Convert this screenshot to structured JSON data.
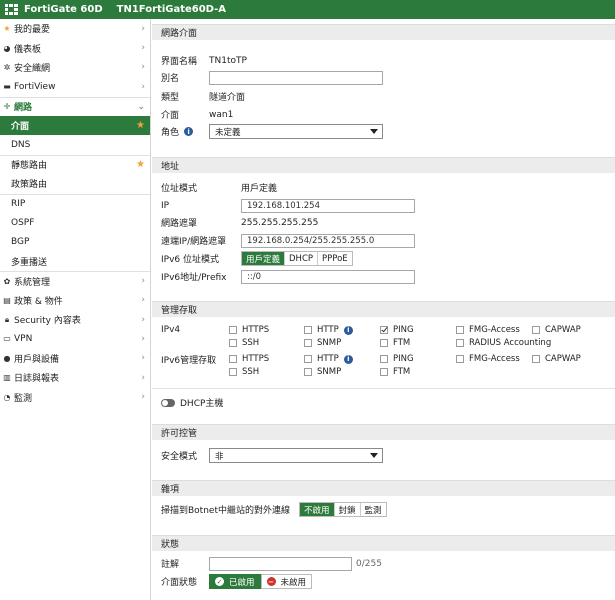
{
  "topbar": {
    "product": "FortiGate 60D",
    "hostname": "TN1FortiGate60D-A"
  },
  "sidebar": {
    "items": [
      {
        "label": "我的最愛",
        "icon": "star-icon"
      },
      {
        "label": "儀表板",
        "icon": "dashboard-icon"
      },
      {
        "label": "安全織網",
        "icon": "fabric-icon"
      },
      {
        "label": "FortiView",
        "icon": "fortiview-icon"
      },
      {
        "label": "網路",
        "icon": "network-icon"
      },
      {
        "label": "介面"
      },
      {
        "label": "DNS"
      },
      {
        "label": "靜態路由"
      },
      {
        "label": "政策路由"
      },
      {
        "label": "RIP"
      },
      {
        "label": "OSPF"
      },
      {
        "label": "BGP"
      },
      {
        "label": "多重播送"
      },
      {
        "label": "系統管理",
        "icon": "gear-icon"
      },
      {
        "label": "政策 & 物件",
        "icon": "policy-icon"
      },
      {
        "label": "Security 內容表",
        "icon": "lock-icon"
      },
      {
        "label": "VPN",
        "icon": "vpn-icon"
      },
      {
        "label": "用戶與設備",
        "icon": "user-icon"
      },
      {
        "label": "日誌與報表",
        "icon": "report-icon"
      },
      {
        "label": "監測",
        "icon": "monitor-icon"
      }
    ]
  },
  "iface": {
    "section": "網路介面",
    "name_label": "界面名稱",
    "name_value": "TN1toTP",
    "alias_label": "別名",
    "alias_value": "",
    "type_label": "類型",
    "type_value": "隧道介面",
    "interface_label": "介面",
    "interface_value": "wan1",
    "role_label": "角色",
    "role_value": "未定義"
  },
  "address": {
    "section": "地址",
    "mode_label": "位址模式",
    "mode_value": "用戶定義",
    "ip_label": "IP",
    "ip_value": "192.168.101.254",
    "mask_label": "網路遮罩",
    "mask_value": "255.255.255.255",
    "remote_label": "遠端IP/網路遮罩",
    "remote_value": "192.168.0.254/255.255.255.0",
    "ipv6mode_label": "IPv6 位址模式",
    "ipv6mode_options": [
      "用戶定義",
      "DHCP",
      "PPPoE"
    ],
    "ipv6addr_label": "IPv6地址/Prefix",
    "ipv6addr_value": "::/0"
  },
  "admin": {
    "section": "管理存取",
    "ipv4_label": "IPv4",
    "ipv6_label": "IPv6管理存取",
    "ipv4": {
      "https": "HTTPS",
      "http": "HTTP",
      "ping": "PING",
      "fmg": "FMG-Access",
      "capwap": "CAPWAP",
      "ssh": "SSH",
      "snmp": "SNMP",
      "ftm": "FTM",
      "radius": "RADIUS Accounting"
    },
    "ipv6": {
      "https": "HTTPS",
      "http": "HTTP",
      "ping": "PING",
      "fmg": "FMG-Access",
      "capwap": "CAPWAP",
      "ssh": "SSH",
      "snmp": "SNMP",
      "ftm": "FTM"
    },
    "dhcp_label": "DHCP主機"
  },
  "license": {
    "section": "許可控管",
    "secmode_label": "安全模式",
    "secmode_value": "非"
  },
  "misc": {
    "section": "雜項",
    "botnet_label": "掃描到Botnet中繼站的對外連線",
    "botnet_options": [
      "不啟用",
      "封鎖",
      "監測"
    ]
  },
  "status": {
    "section": "狀態",
    "comment_label": "註解",
    "comment_value": "",
    "comment_count": "0/255",
    "state_label": "介面狀態",
    "enabled": "已啟用",
    "disabled": "未啟用"
  }
}
